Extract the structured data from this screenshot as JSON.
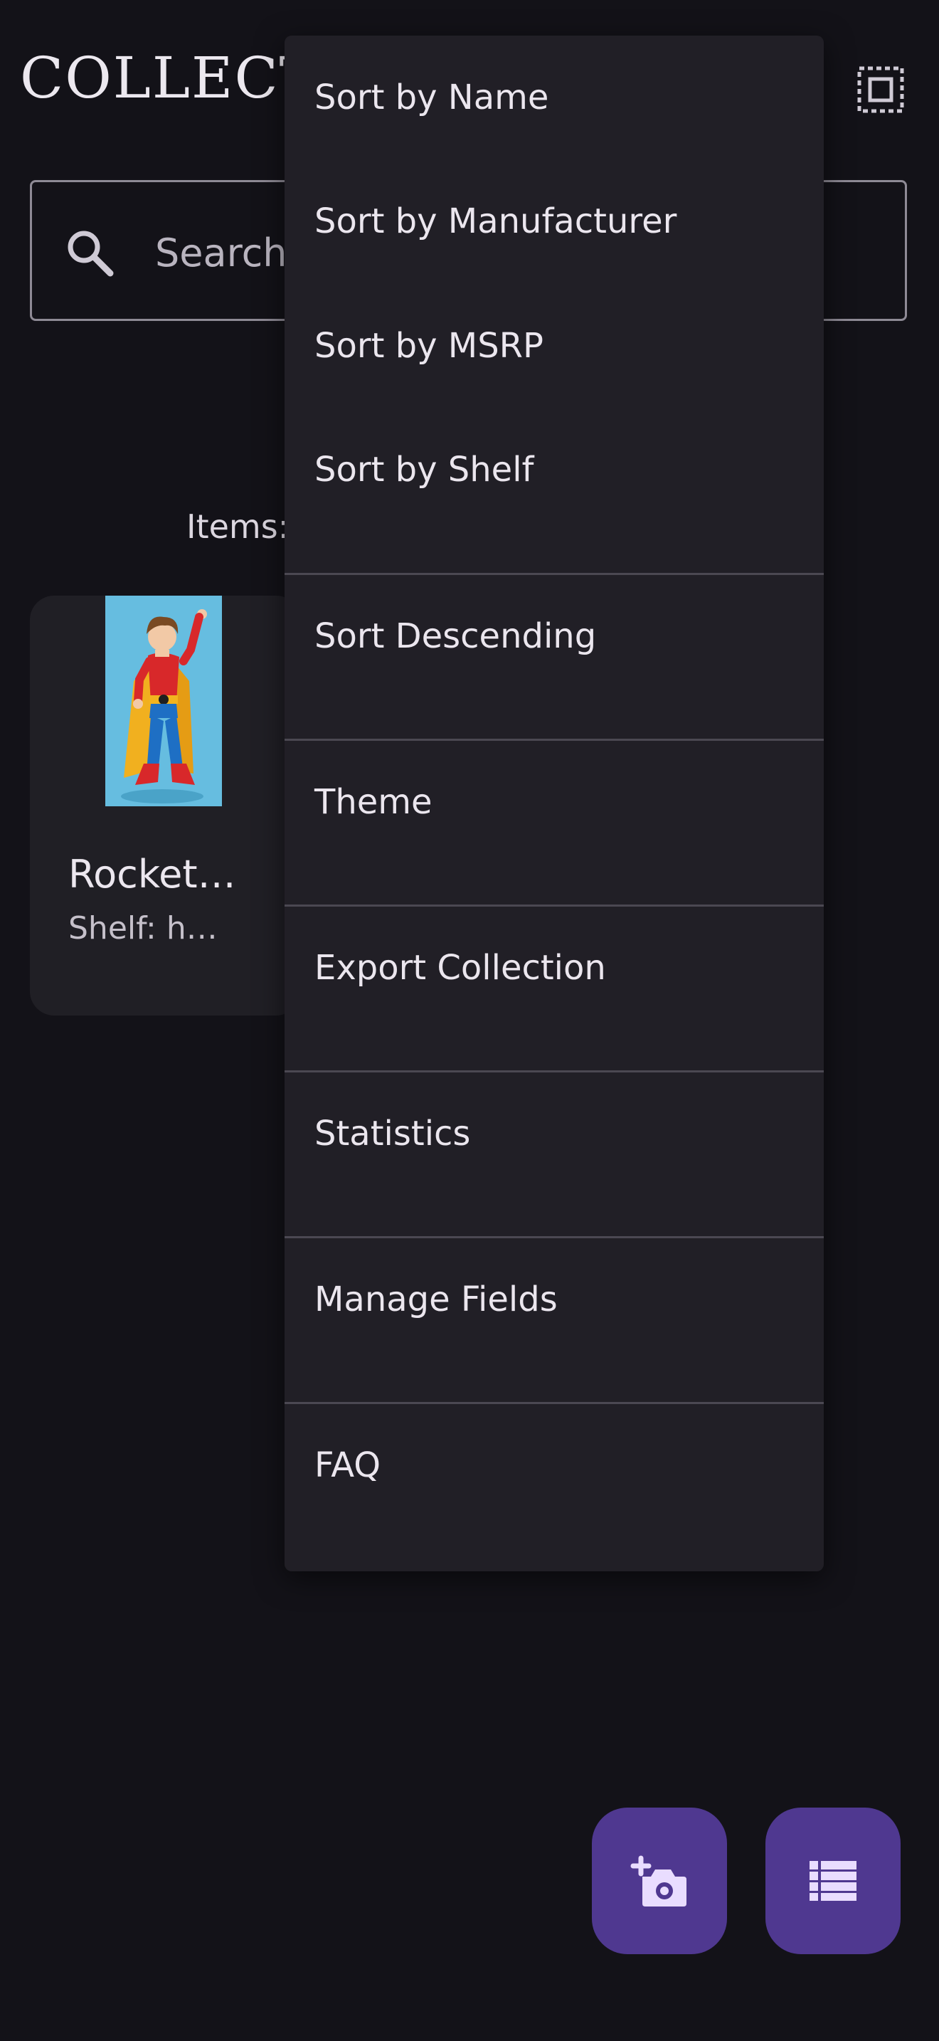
{
  "header": {
    "title": "COLLECTO",
    "select_icon": "select-all-icon"
  },
  "search": {
    "placeholder": "Search",
    "icon": "search-icon"
  },
  "summary": {
    "items_label": "Items:"
  },
  "items": [
    {
      "name": "Rocket…",
      "shelf": "Shelf: h…"
    }
  ],
  "menu": {
    "items": [
      "Sort by Name",
      "Sort by Manufacturer",
      "Sort by MSRP",
      "Sort by Shelf",
      "Sort Descending",
      "Theme",
      "Export Collection",
      "Statistics",
      "Manage Fields",
      "FAQ"
    ]
  },
  "fabs": {
    "add_photo_icon": "add-photo-icon",
    "list_icon": "list-view-icon"
  },
  "colors": {
    "background": "#131218",
    "menu_background": "#211f26",
    "fab": "#4f3890",
    "fab_icon": "#e9ddff"
  }
}
